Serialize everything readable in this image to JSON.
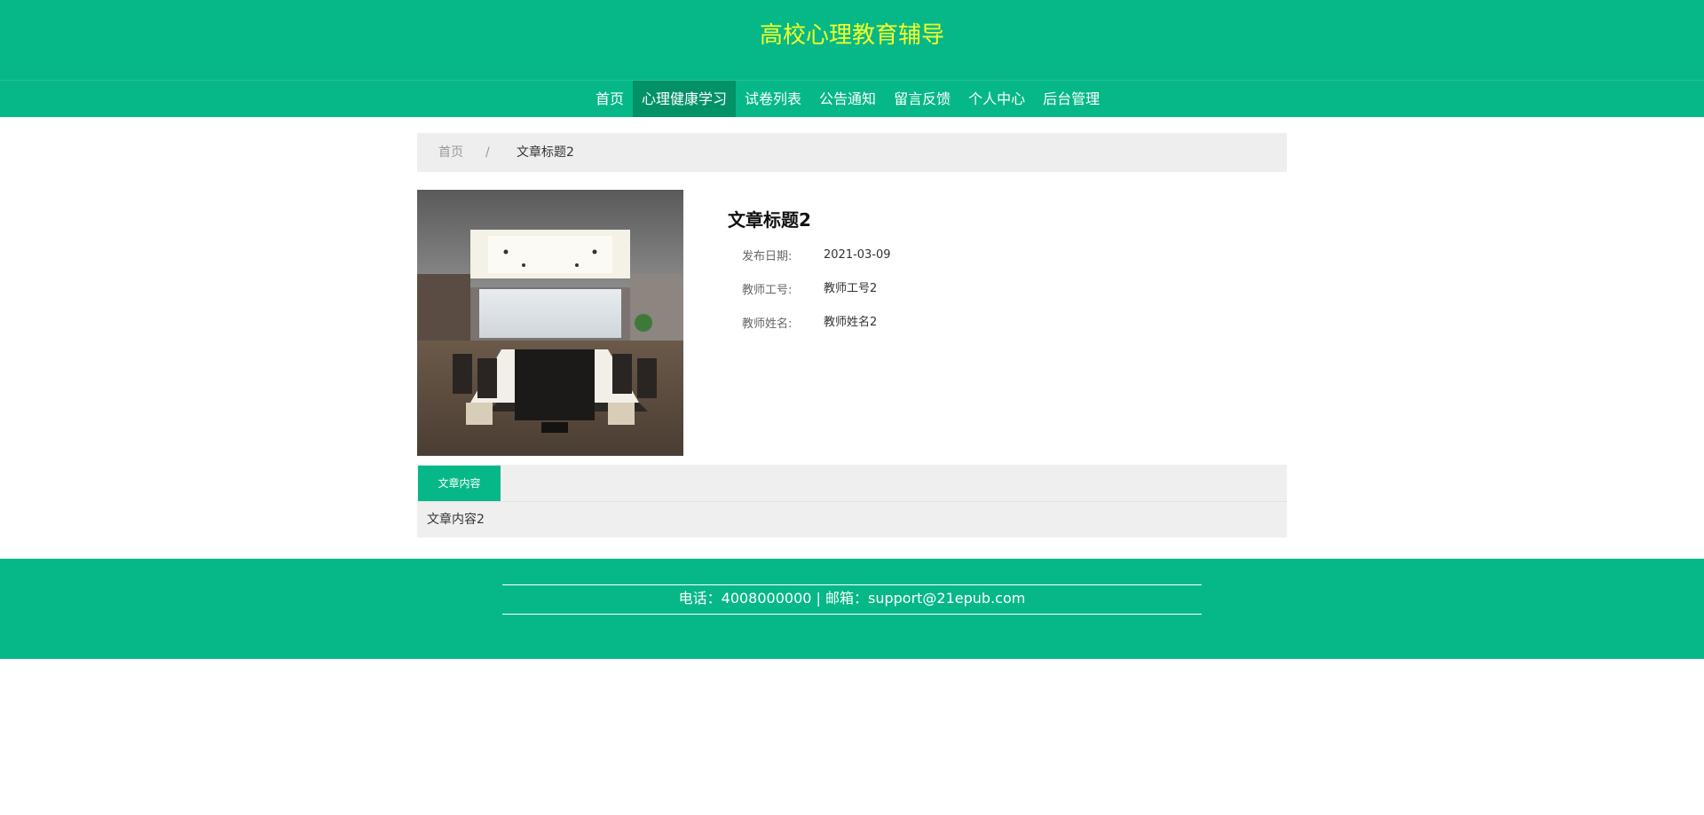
{
  "header": {
    "title": "高校心理教育辅导"
  },
  "nav": {
    "items": [
      {
        "label": "首页"
      },
      {
        "label": "心理健康学习"
      },
      {
        "label": "试卷列表"
      },
      {
        "label": "公告通知"
      },
      {
        "label": "留言反馈"
      },
      {
        "label": "个人中心"
      },
      {
        "label": "后台管理"
      }
    ],
    "active_index": 1
  },
  "breadcrumb": {
    "home": "首页",
    "separator": "/",
    "current": "文章标题2"
  },
  "article": {
    "image_icon": "conference-room-photo",
    "title": "文章标题2",
    "fields": [
      {
        "label": "发布日期:",
        "value": "2021-03-09"
      },
      {
        "label": "教师工号:",
        "value": "教师工号2"
      },
      {
        "label": "教师姓名:",
        "value": "教师姓名2"
      }
    ]
  },
  "tabs": {
    "active_label": "文章内容",
    "content": "文章内容2"
  },
  "footer": {
    "contact": "电话：4008000000 | 邮箱：support@21epub.com"
  },
  "colors": {
    "primary": "#06b887",
    "nav_active": "#039168",
    "title": "#f4ff2a",
    "panel_bg": "#eeeeee"
  }
}
